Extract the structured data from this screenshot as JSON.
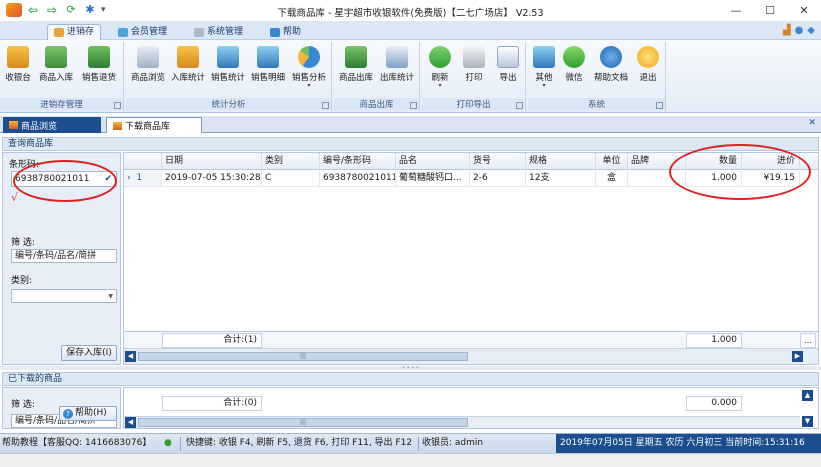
{
  "window": {
    "title": "下载商品库 - 星宇超市收银软件(免费版)【二七广场店】 V2.53",
    "controls": {
      "minimize": "—",
      "maximize": "☐",
      "close": "✕"
    }
  },
  "quick_access": {
    "more": "▾"
  },
  "ribbon_tabs": [
    {
      "label": "进销存"
    },
    {
      "label": "会员管理"
    },
    {
      "label": "系统管理"
    },
    {
      "label": "帮助"
    }
  ],
  "ribbon_groups": {
    "inventory": {
      "label": "进销存管理",
      "buttons": [
        "收银台",
        "商品入库",
        "销售退货"
      ]
    },
    "stats": {
      "label": "统计分析",
      "buttons": [
        "商品浏览",
        "入库统计",
        "销售统计",
        "销售明细",
        "销售分析"
      ]
    },
    "outbound": {
      "label": "商品出库",
      "buttons": [
        "商品出库",
        "出库统计"
      ]
    },
    "print": {
      "label": "打印导出",
      "buttons": [
        "刷新",
        "打印",
        "导出"
      ]
    },
    "system": {
      "label": "系统",
      "buttons": [
        "其他",
        "微信",
        "帮助文档",
        "退出"
      ]
    }
  },
  "doc_tabs": [
    {
      "label": "商品浏览"
    },
    {
      "label": "下载商品库"
    }
  ],
  "query_section": {
    "title": "查询商品库",
    "barcode_label": "条形码:",
    "barcode_value": "6938780021011",
    "filter_label": "筛  选:",
    "filter_value": "编号/条码/品名/简拼",
    "category_label": "类别:",
    "category_value": "",
    "save_button": "保存入库(I)"
  },
  "grid": {
    "columns": [
      "日期",
      "类别",
      "编号/条形码",
      "品名",
      "货号",
      "规格",
      "单位",
      "品牌",
      "数量",
      "进价"
    ],
    "rows": [
      {
        "index": "1",
        "date": "2019-07-05 15:30:28",
        "category": "C",
        "code": "6938780021011",
        "name": "葡萄糖酸钙口...",
        "item_no": "2-6",
        "spec": "12支",
        "unit": "盒",
        "brand": "",
        "qty": "1.000",
        "price": "¥19.15"
      }
    ],
    "summary": {
      "total_label": "合计:(1)",
      "qty_total": "1.000"
    }
  },
  "downloaded_section": {
    "title": "已下载的商品",
    "filter_label": "筛  选:",
    "filter_value": "编号/条码/品名/简拼",
    "help_button": "帮助(H)",
    "summary": {
      "total_label": "合计:(0)",
      "qty_total": "0.000"
    }
  },
  "statusbar": {
    "help": "帮助教程【客服QQ: 1416683076】",
    "shortcuts": "快捷键: 收银 F4, 刷新 F5, 退货 F6, 打印 F11, 导出 F12",
    "cashier": "收银员: admin",
    "datetime": "2019年07月05日 星期五 农历 六月初三 当前时间:15:31:16"
  }
}
